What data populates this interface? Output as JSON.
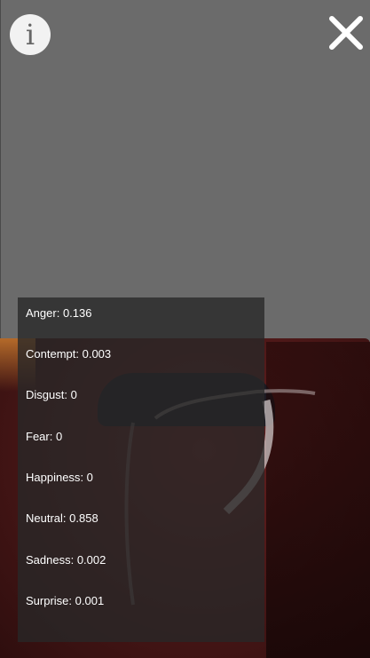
{
  "icons": {
    "info": "info-icon",
    "close": "close-icon"
  },
  "emotions": [
    {
      "name": "Anger",
      "value": "0.136"
    },
    {
      "name": "Contempt",
      "value": "0.003"
    },
    {
      "name": "Disgust",
      "value": "0"
    },
    {
      "name": "Fear",
      "value": "0"
    },
    {
      "name": "Happiness",
      "value": "0"
    },
    {
      "name": "Neutral",
      "value": "0.858"
    },
    {
      "name": "Sadness",
      "value": "0.002"
    },
    {
      "name": "Surprise",
      "value": "0.001"
    }
  ],
  "colors": {
    "background": "#6b6b6b",
    "panel": "#282828",
    "text": "#ffffff"
  }
}
